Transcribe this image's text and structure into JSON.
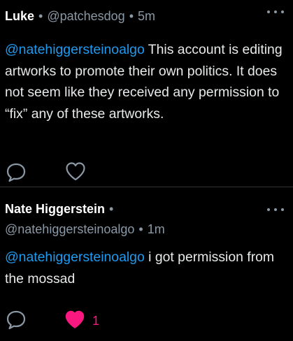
{
  "posts": [
    {
      "author": "Luke",
      "handle": "@patchesdog",
      "separator": "•",
      "time": "5m",
      "text_mention": "@natehiggersteinoalgo",
      "text_body": " This account is editing artworks to promote their own politics. It does not seem like they received any permission to “fix” any of these artworks.",
      "liked": false,
      "like_count": ""
    },
    {
      "author": "Nate Higgerstein",
      "handle": "@natehiggersteinoalgo",
      "separator": "•",
      "time": "1m",
      "text_mention": "@natehiggersteinoalgo",
      "text_body": " i got permission from the mossad",
      "liked": true,
      "like_count": "1"
    }
  ],
  "icons": {
    "more": "more-horizontal-icon",
    "reply": "reply-bubble-icon",
    "like": "heart-icon"
  },
  "colors": {
    "background": "#000000",
    "text": "#e7e9ea",
    "secondary": "#8b98a5",
    "mention": "#1d9bf0",
    "like_active": "#f91880"
  }
}
